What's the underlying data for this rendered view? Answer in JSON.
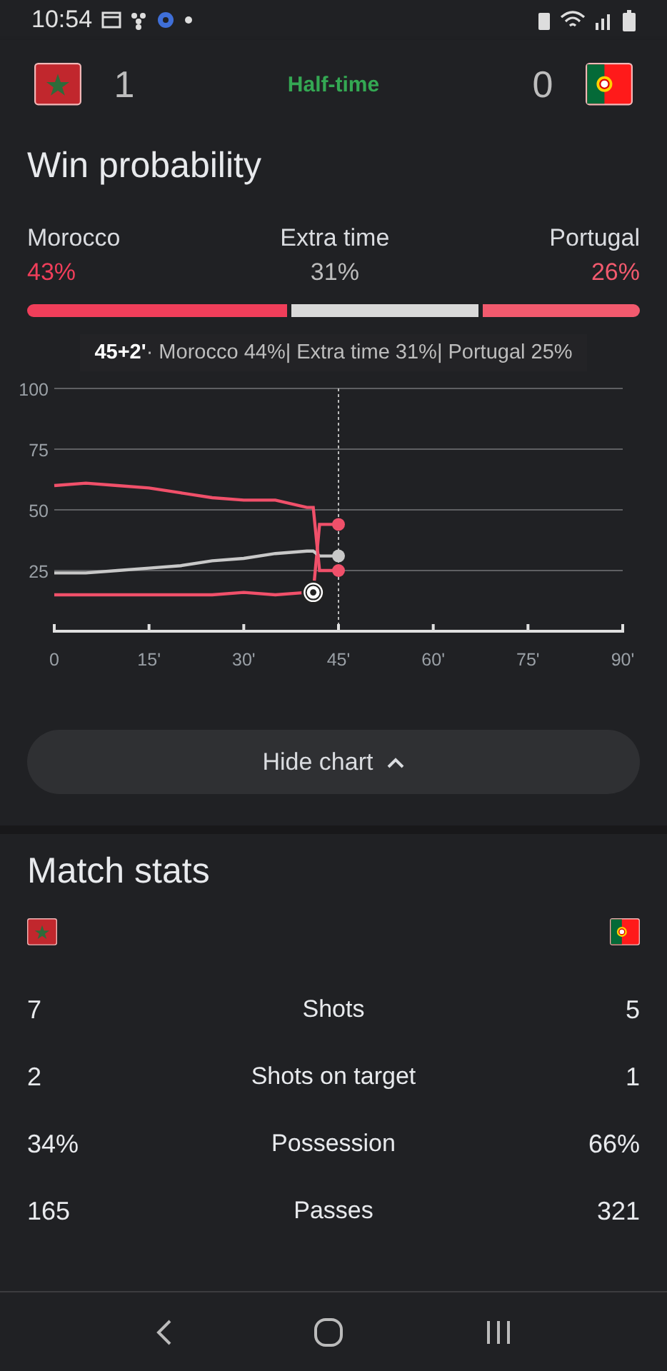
{
  "status_bar": {
    "time": "10:54"
  },
  "score": {
    "home_score": "1",
    "status": "Half-time",
    "away_score": "0"
  },
  "win_probability": {
    "title": "Win probability",
    "outcomes": [
      {
        "label": "Morocco",
        "value": "43%",
        "color": "#f03e5a"
      },
      {
        "label": "Extra time",
        "value": "31%",
        "color": "#d9d9d9"
      },
      {
        "label": "Portugal",
        "value": "26%",
        "color": "#f25a6e"
      }
    ],
    "tooltip": {
      "time": "45+2'",
      "dot": "·",
      "values": [
        "44%|",
        "31%|",
        "25%"
      ]
    },
    "chart_data": {
      "type": "line",
      "x": [
        0,
        5,
        10,
        15,
        20,
        25,
        30,
        35,
        40,
        41,
        42,
        45
      ],
      "series": [
        {
          "name": "Morocco",
          "color": "#f0506a",
          "values": [
            15,
            15,
            15,
            15,
            15,
            15,
            16,
            15,
            16,
            16,
            44,
            44
          ]
        },
        {
          "name": "Extra time",
          "color": "#c8c8c8",
          "values": [
            24,
            24,
            25,
            26,
            27,
            29,
            30,
            32,
            33,
            33,
            31,
            31
          ]
        },
        {
          "name": "Portugal",
          "color": "#f0506a",
          "values": [
            60,
            61,
            60,
            59,
            57,
            55,
            54,
            54,
            51,
            51,
            25,
            25
          ]
        }
      ],
      "xlim": [
        0,
        90
      ],
      "ylim": [
        0,
        100
      ],
      "grid": true,
      "ref_lines": [
        {
          "axis": "x",
          "value": 45
        }
      ],
      "xticks": [
        0,
        {
          "value": 15,
          "label": "15'"
        },
        {
          "value": 30,
          "label": "30'"
        },
        {
          "value": 45,
          "label": "45'"
        },
        {
          "value": 60,
          "label": "60'"
        },
        {
          "value": 75,
          "label": "75'"
        },
        {
          "value": 90,
          "label": "90'"
        }
      ],
      "yticks": [
        25,
        50,
        75,
        100
      ]
    },
    "toggle_button": "Hide chart"
  },
  "match_stats": {
    "title": "Match stats",
    "rows": [
      {
        "home": "7",
        "label": "Shots",
        "away": "5"
      },
      {
        "home": "2",
        "label": "Shots on target",
        "away": "1"
      },
      {
        "home": "34%",
        "label": "Possession",
        "away": "66%"
      },
      {
        "home": "165",
        "label": "Passes",
        "away": "321"
      }
    ]
  }
}
